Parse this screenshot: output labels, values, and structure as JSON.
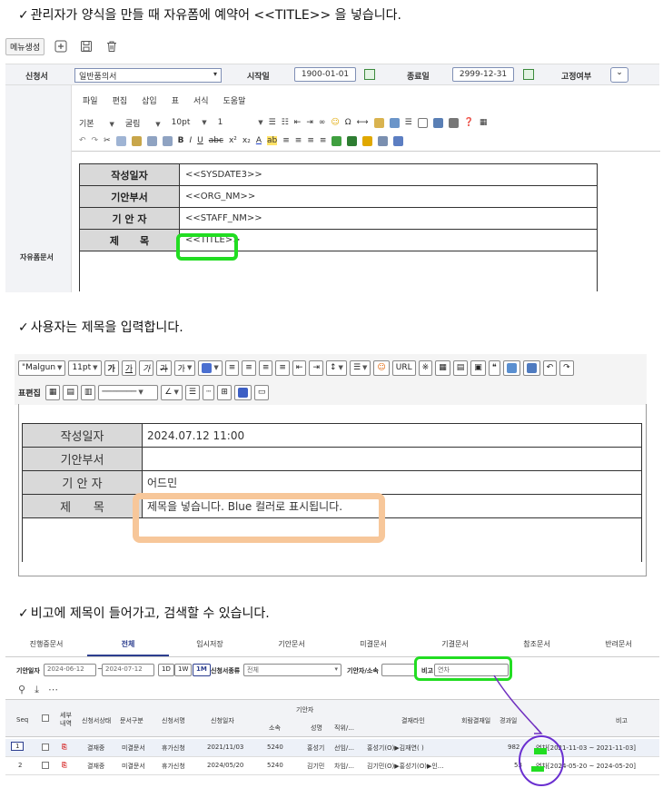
{
  "captions": {
    "step1": "관리자가 양식을 만들 때 자유폼에 예약어 <<TITLE>> 을 넣습니다.",
    "step2": "사용자는 제목을 입력합니다.",
    "step3": "비고에 제목이 들어가고, 검색할 수 있습니다.",
    "check": "✓"
  },
  "section1": {
    "menu_button": "메뉴생성",
    "form": {
      "request_label": "신청서",
      "request_value": "일반품의서",
      "start_label": "시작일",
      "start_value": "1900-01-01",
      "end_label": "종료일",
      "end_value": "2999-12-31",
      "fixed_label": "고정여부"
    },
    "free_form_label": "자유폼문서",
    "editor_menu": [
      "파일",
      "편집",
      "삽입",
      "표",
      "서식",
      "도움말"
    ],
    "editor_format": {
      "style": "기본",
      "font": "굴림",
      "size": "10pt",
      "line": "1"
    },
    "table": [
      {
        "label": "작성일자",
        "value": "<<SYSDATE3>>"
      },
      {
        "label": "기안부서",
        "value": "<<ORG_NM>>"
      },
      {
        "label": "기 안 자",
        "value": "<<STAFF_NM>>"
      },
      {
        "label": "제      목",
        "value": "<<TITLE>>"
      }
    ]
  },
  "section2": {
    "font": "\"Malgun",
    "size": "11pt",
    "table_edit_label": "표편집",
    "url_label": "URL",
    "table": [
      {
        "label": "작성일자",
        "value": "2024.07.12 11:00"
      },
      {
        "label": "기안부서",
        "value": ""
      },
      {
        "label": "기 안 자",
        "value": "어드민"
      },
      {
        "label": "제      목",
        "value": "제목을 넣습니다. Blue 컬러로 표시됩니다."
      }
    ]
  },
  "section3": {
    "tabs": [
      "진행중문서",
      "전체",
      "임시저장",
      "기안문서",
      "미결문서",
      "기결문서",
      "참조문서",
      "반려문서"
    ],
    "active_tab": "전체",
    "filter": {
      "date_label": "기안일자",
      "date_from": "2024-06-12",
      "date_to": "2024-07-12",
      "range_buttons": [
        "1D",
        "1W",
        "1M"
      ],
      "active_range": "1M",
      "type_label": "신청서종류",
      "type_value": "전체",
      "drafter_label": "기안자/소속",
      "note_label": "비고",
      "note_value": "연차"
    },
    "columns": {
      "seq": "Seq",
      "detail": "세부\n내역",
      "status": "신청서상태",
      "doc_type": "문서구분",
      "form_name": "신청서명",
      "req_date": "신청일자",
      "drafter_group": "기안자",
      "dept": "소속",
      "name": "성명",
      "position": "직위/...",
      "approver": "결재라인",
      "coop": "회람결재일",
      "elapsed": "경과일",
      "note": "비고"
    },
    "rows": [
      {
        "seq": "1",
        "status": "결재중",
        "doc_type": "미결문서",
        "form_name": "휴가신청",
        "req_date": "2021/11/03",
        "dept": "5240",
        "name": "홍성기",
        "position": "선임/...",
        "approver": "홍성기(O)▶김재연( )",
        "elapsed": "982",
        "note": "연차[2021-11-03 ~ 2021-11-03]"
      },
      {
        "seq": "2",
        "status": "결재중",
        "doc_type": "미결문서",
        "form_name": "휴가신청",
        "req_date": "2024/05/20",
        "dept": "5240",
        "name": "김기민",
        "position": "차임/...",
        "approver": "김기민(O)▶홍성기(O)▶인...",
        "elapsed": "53",
        "note": "연차[2024-05-20 ~ 2024-05-20]"
      }
    ]
  }
}
